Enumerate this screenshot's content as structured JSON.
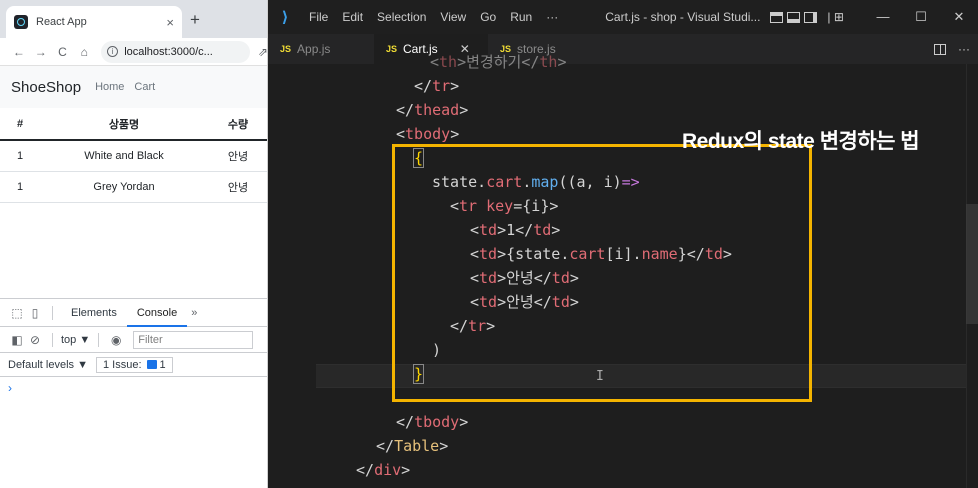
{
  "browser": {
    "tab_title": "React App",
    "tab_close": "×",
    "new_tab": "+",
    "back": "←",
    "forward": "→",
    "reload": "C",
    "home": "⌂",
    "url": "localhost:3000/c...",
    "share": "⇗"
  },
  "app": {
    "brand": "ShoeShop",
    "nav": [
      "Home",
      "Cart"
    ],
    "table": {
      "headers": [
        "#",
        "상품명",
        "수량"
      ],
      "rows": [
        [
          "1",
          "White and Black",
          "안녕"
        ],
        [
          "1",
          "Grey Yordan",
          "안녕"
        ]
      ]
    }
  },
  "devtools": {
    "tabs": [
      "Elements",
      "Console"
    ],
    "active_tab": "Console",
    "more": "»",
    "context": "top ▼",
    "filter_placeholder": "Filter",
    "levels": "Default levels ▼",
    "issues": "1 Issue:",
    "issue_count": "1",
    "prompt": "›"
  },
  "vscode": {
    "menu": [
      "File",
      "Edit",
      "Selection",
      "View",
      "Go",
      "Run",
      "···"
    ],
    "window_title": "Cart.js - shop - Visual Studi...",
    "window_controls": [
      "—",
      "☐",
      "✕"
    ],
    "tabs": [
      {
        "label": "App.js",
        "active": false
      },
      {
        "label": "Cart.js",
        "active": true
      },
      {
        "label": "store.js",
        "active": false
      }
    ],
    "tab_more": "···",
    "annotation": "Redux의 state 변경하는 법"
  }
}
